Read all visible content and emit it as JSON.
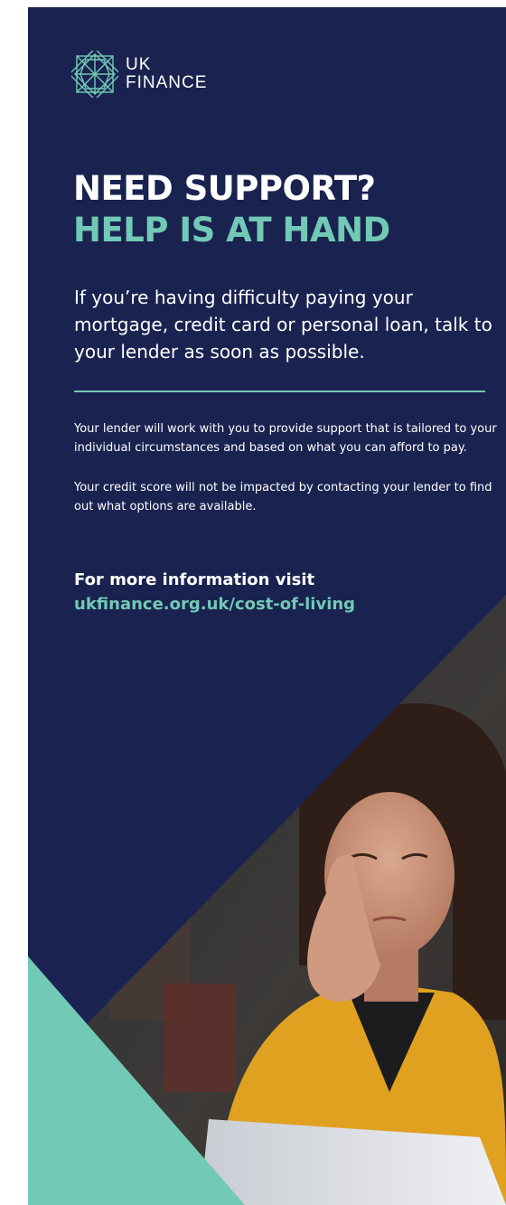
{
  "logo": {
    "line1": "UK",
    "line2": "FINANCE"
  },
  "headline": {
    "line1": "NEED SUPPORT?",
    "line2": "HELP IS AT HAND"
  },
  "intro": "If you’re having difficulty paying your mortgage, credit card or personal loan, talk to your lender as soon as possible.",
  "paragraphs": [
    "Your lender will work with you to provide support that is tailored to your individual circumstances and based on what you can afford to pay.",
    "Your credit score will not be impacted by contacting your lender to find out what options are available."
  ],
  "cta": {
    "lead": "For more information visit",
    "url": "ukfinance.org.uk/cost-of-living"
  },
  "colors": {
    "navy": "#1a2350",
    "teal": "#72c9b5",
    "white": "#ffffff",
    "mustard": "#e0a020"
  },
  "photo": {
    "subject": "worried-woman-reading-bill-photo"
  }
}
